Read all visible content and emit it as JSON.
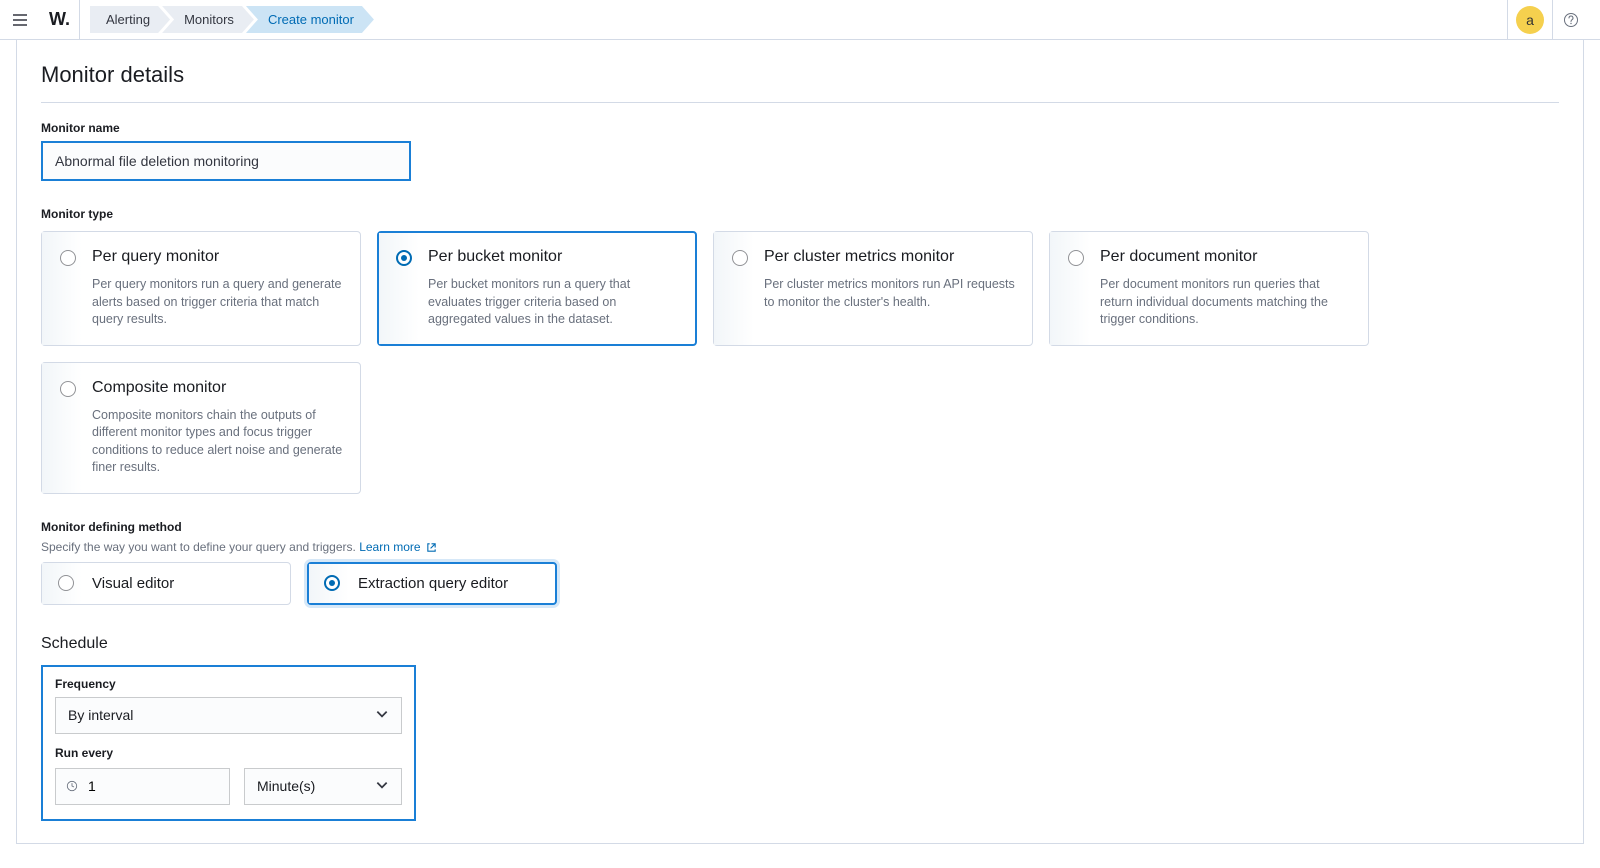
{
  "header": {
    "logo": "W.",
    "breadcrumbs": [
      "Alerting",
      "Monitors",
      "Create monitor"
    ],
    "avatar_initial": "a"
  },
  "section": {
    "title": "Monitor details",
    "name_label": "Monitor name",
    "name_value": "Abnormal file deletion monitoring",
    "type_label": "Monitor type",
    "types": [
      {
        "title": "Per query monitor",
        "desc": "Per query monitors run a query and generate alerts based on trigger criteria that match query results.",
        "selected": false
      },
      {
        "title": "Per bucket monitor",
        "desc": "Per bucket monitors run a query that evaluates trigger criteria based on aggregated values in the dataset.",
        "selected": true
      },
      {
        "title": "Per cluster metrics monitor",
        "desc": "Per cluster metrics monitors run API requests to monitor the cluster's health.",
        "selected": false
      },
      {
        "title": "Per document monitor",
        "desc": "Per document monitors run queries that return individual documents matching the trigger conditions.",
        "selected": false
      },
      {
        "title": "Composite monitor",
        "desc": "Composite monitors chain the outputs of different monitor types and focus trigger conditions to reduce alert noise and generate finer results.",
        "selected": false
      }
    ],
    "method_label": "Monitor defining method",
    "method_help": "Specify the way you want to define your query and triggers.",
    "learn_more": "Learn more",
    "methods": [
      {
        "title": "Visual editor",
        "selected": false
      },
      {
        "title": "Extraction query editor",
        "selected": true
      }
    ],
    "schedule": {
      "title": "Schedule",
      "frequency_label": "Frequency",
      "frequency_value": "By interval",
      "run_every_label": "Run every",
      "interval_value": "1",
      "unit_value": "Minute(s)"
    }
  }
}
